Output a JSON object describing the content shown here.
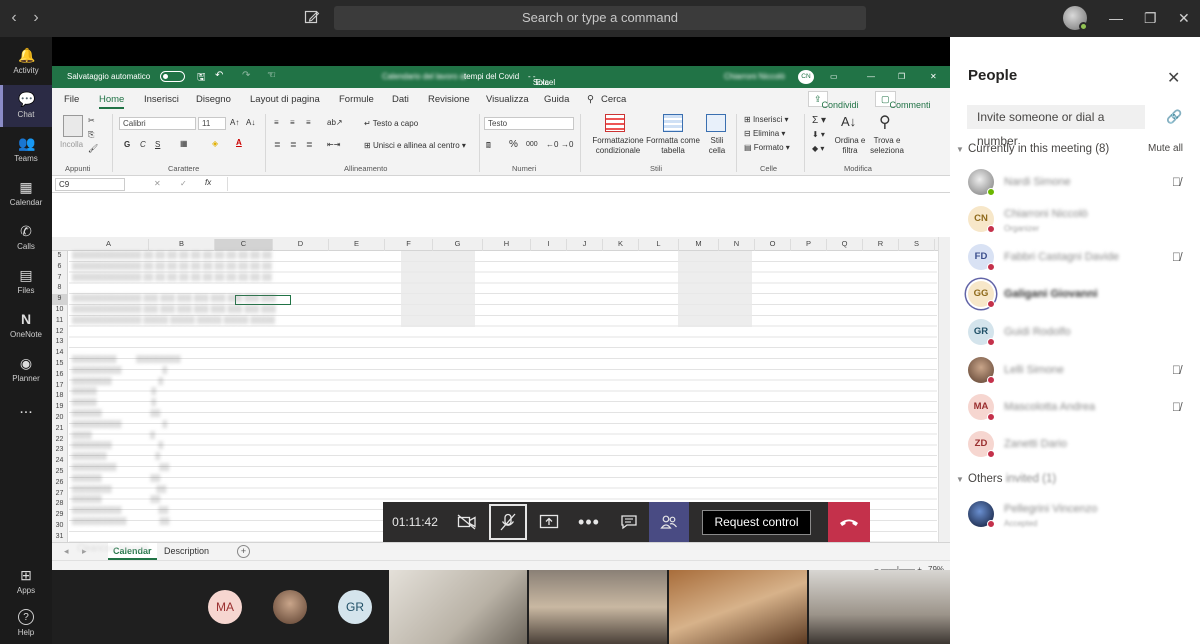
{
  "titlebar": {
    "search_placeholder": "Search or type a command",
    "icons": [
      "back-arrow-icon",
      "forward-arrow-icon",
      "compose-icon",
      "minimize-icon",
      "maximize-icon",
      "close-icon"
    ]
  },
  "rail": {
    "items": [
      {
        "label": "Activity",
        "icon": "bell-icon",
        "glyph": "🔔"
      },
      {
        "label": "Chat",
        "icon": "chat-icon",
        "glyph": "💬"
      },
      {
        "label": "Teams",
        "icon": "teams-icon",
        "glyph": "👥"
      },
      {
        "label": "Calendar",
        "icon": "calendar-icon",
        "glyph": "▦"
      },
      {
        "label": "Calls",
        "icon": "phone-icon",
        "glyph": "✆"
      },
      {
        "label": "Files",
        "icon": "file-icon",
        "glyph": "▤"
      },
      {
        "label": "OneNote",
        "icon": "onenote-icon",
        "glyph": "N"
      },
      {
        "label": "Planner",
        "icon": "planner-icon",
        "glyph": "◉"
      },
      {
        "label": "...",
        "icon": "more-icon",
        "glyph": ""
      },
      {
        "label": "Apps",
        "icon": "apps-icon",
        "glyph": "⊞"
      },
      {
        "label": "Help",
        "icon": "help-icon",
        "glyph": "?"
      }
    ],
    "active": "Chat"
  },
  "excel": {
    "autosave_label": "Salvataggio automatico",
    "doc_title": "tempi del Covid",
    "readonly": "Sola lettura",
    "app": "Excel",
    "user_initials": "CN",
    "tabs": [
      "File",
      "Home",
      "Inserisci",
      "Disegno",
      "Layout di pagina",
      "Formule",
      "Dati",
      "Revisione",
      "Visualizza",
      "Guida"
    ],
    "search_label": "Cerca",
    "share_label": "Condividi",
    "comments_label": "Commenti",
    "ribbon": {
      "paste": "Incolla",
      "font": "Calibri",
      "size": "11",
      "bold": "G",
      "italic": "C",
      "underline": "S",
      "wrap": "Testo a capo",
      "merge": "Unisci e allinea al centro",
      "numfmt": "Testo",
      "percent": "%",
      "thousands": "000",
      "cond_fmt": "Formattazione condizionale",
      "table_fmt": "Formatta come tabella",
      "cell_styles": "Stili cella",
      "insert": "Inserisci",
      "delete": "Elimina",
      "format": "Formato",
      "sort": "Ordina e filtra",
      "find": "Trova e seleziona",
      "groups": [
        "Appunti",
        "Carattere",
        "Allineamento",
        "Numeri",
        "Stili",
        "Celle",
        "Modifica"
      ]
    },
    "namebox": "C9",
    "fx": "fx",
    "columns": [
      "A",
      "B",
      "C",
      "D",
      "E",
      "F",
      "G",
      "H",
      "I",
      "J",
      "K",
      "L",
      "M",
      "N",
      "O",
      "P",
      "Q",
      "R",
      "S"
    ],
    "rows": [
      "5",
      "6",
      "7",
      "8",
      "9",
      "10",
      "11",
      "12",
      "13",
      "14",
      "15",
      "16",
      "17",
      "18",
      "19",
      "20",
      "21",
      "22",
      "23",
      "24",
      "25",
      "26",
      "27",
      "28",
      "29",
      "30",
      "31"
    ],
    "sheets": [
      "Calendar",
      "Description"
    ],
    "add_sheet": "+",
    "zoom": "79%"
  },
  "presenter_label": "Cleancosi Niccolò",
  "controls": {
    "timer": "01:11:42",
    "request_control": "Request control",
    "icons": [
      "camera-off-icon",
      "mic-off-icon",
      "share-screen-icon",
      "more-icon",
      "chat-icon",
      "participants-icon",
      "hangup-icon"
    ]
  },
  "strip": {
    "avatars": [
      "MA",
      "GR"
    ],
    "video_count": 4
  },
  "people": {
    "title": "People",
    "invite_placeholder": "Invite someone or dial a number",
    "section_meeting": "Currently in this meeting (8)",
    "mute_all": "Mute all",
    "section_others": "Others",
    "section_others_extra": "invited (1)",
    "participants": [
      {
        "initials": "",
        "name": "Nardi Simone",
        "sub": "",
        "color": "#7a7a7a",
        "bg": "#e0e0e0",
        "status": "green",
        "muted": true
      },
      {
        "initials": "CN",
        "name": "Chiarroni Niccolò",
        "sub": "Organizer",
        "color": "#8f6a1b",
        "bg": "#f7e7c9",
        "status": "red",
        "muted": false
      },
      {
        "initials": "FD",
        "name": "Fabbri Castagni Davide",
        "sub": "",
        "color": "#3b4e8c",
        "bg": "#d9e2f4",
        "status": "red",
        "muted": true
      },
      {
        "initials": "GG",
        "name": "Galigani Giovanni",
        "sub": "",
        "color": "#8f6a1b",
        "bg": "#f7e7c9",
        "status": "red",
        "muted": false
      },
      {
        "initials": "GR",
        "name": "Guidi Rodolfo",
        "sub": "",
        "color": "#1f4f66",
        "bg": "#d4e4ec",
        "status": "red",
        "muted": false
      },
      {
        "initials": "",
        "name": "Lelli Simone",
        "sub": "",
        "color": "#7a7a7a",
        "bg": "#b58f7a",
        "status": "red",
        "muted": true
      },
      {
        "initials": "MA",
        "name": "Mascolotta Andrea",
        "sub": "",
        "color": "#9a2f2f",
        "bg": "#f6d6d0",
        "status": "red",
        "muted": true
      },
      {
        "initials": "ZD",
        "name": "Zanetti Dario",
        "sub": "",
        "color": "#9a2f2f",
        "bg": "#f6d6d0",
        "status": "red",
        "muted": false
      }
    ],
    "others": [
      {
        "initials": "",
        "name": "Pellegrini Vincenzo",
        "sub": "Accepted",
        "color": "#7a7a7a",
        "bg": "#1a2a4a",
        "status": "red",
        "muted": false
      }
    ]
  }
}
